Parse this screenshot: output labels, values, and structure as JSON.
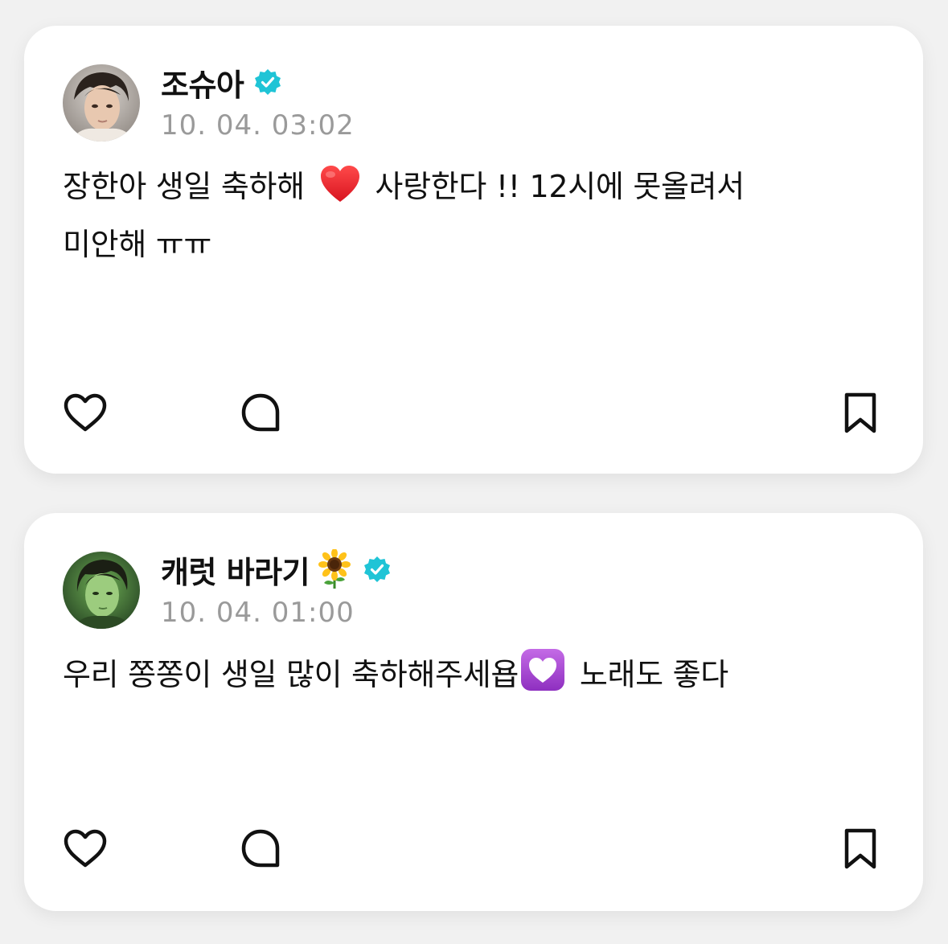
{
  "posts": [
    {
      "username": "조슈아",
      "verified": true,
      "name_emoji": "",
      "timestamp": "10. 04. 03:02",
      "text_before_emoji": "장한아 생일 축하해",
      "text_emoji": "red-heart",
      "text_after_emoji": "사랑한다 !! 12시에 못올려서",
      "text_line2": "미안해 ㅠㅠ",
      "avatar_icon": "user-photo-avatar"
    },
    {
      "username": "캐럿 바라기",
      "verified": true,
      "name_emoji": "sunflower",
      "timestamp": "10. 04. 01:00",
      "text_before_emoji": "우리 쫑쫑이 생일 많이 축하해주세욥",
      "text_emoji": "heart-decoration",
      "text_after_emoji": "노래도 좋다",
      "text_line2": "",
      "avatar_icon": "user-photo-avatar"
    }
  ],
  "colors": {
    "background": "#f1f1f1",
    "card": "#ffffff",
    "verified_badge": "#1fc4d6",
    "timestamp": "#9a9a9a",
    "text": "#111111"
  },
  "icons": {
    "like": "heart-outline-icon",
    "comment": "speech-bubble-icon",
    "bookmark": "bookmark-icon"
  }
}
